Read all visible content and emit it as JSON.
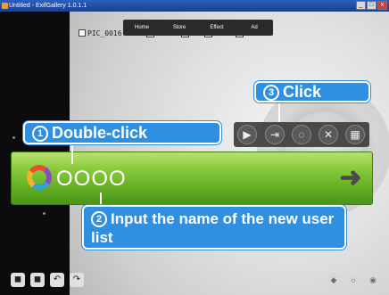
{
  "window": {
    "title": "Untitled - ExifGallery 1.0.1.1",
    "min_label": "_",
    "max_label": "□",
    "close_label": "x"
  },
  "menubar": {
    "items": [
      "Home",
      "Store",
      "Effect",
      "Ad"
    ]
  },
  "file": {
    "label": "PIC_0016"
  },
  "toolbar": {
    "icons": [
      "play-icon",
      "import-icon",
      "shape-icon",
      "close-icon",
      "grid-icon"
    ],
    "glyphs": [
      "▶",
      "⇥",
      "◌",
      "✕",
      "▦"
    ]
  },
  "list": {
    "name": "OOOO",
    "arrow": "➜"
  },
  "callouts": {
    "c1": {
      "num": "1",
      "text": "Double-click"
    },
    "c2": {
      "num": "2",
      "text": "Input the name of the new user list"
    },
    "c3": {
      "num": "3",
      "text": "Click"
    }
  },
  "bottom_left": {
    "glyphs": [
      "◼",
      "◼",
      "↶",
      "↷"
    ]
  },
  "bottom_right": {
    "glyphs": [
      "◆",
      "☼",
      "◉"
    ]
  },
  "colors": {
    "accent": "#2f8fe0",
    "bar": "#62ad25"
  }
}
